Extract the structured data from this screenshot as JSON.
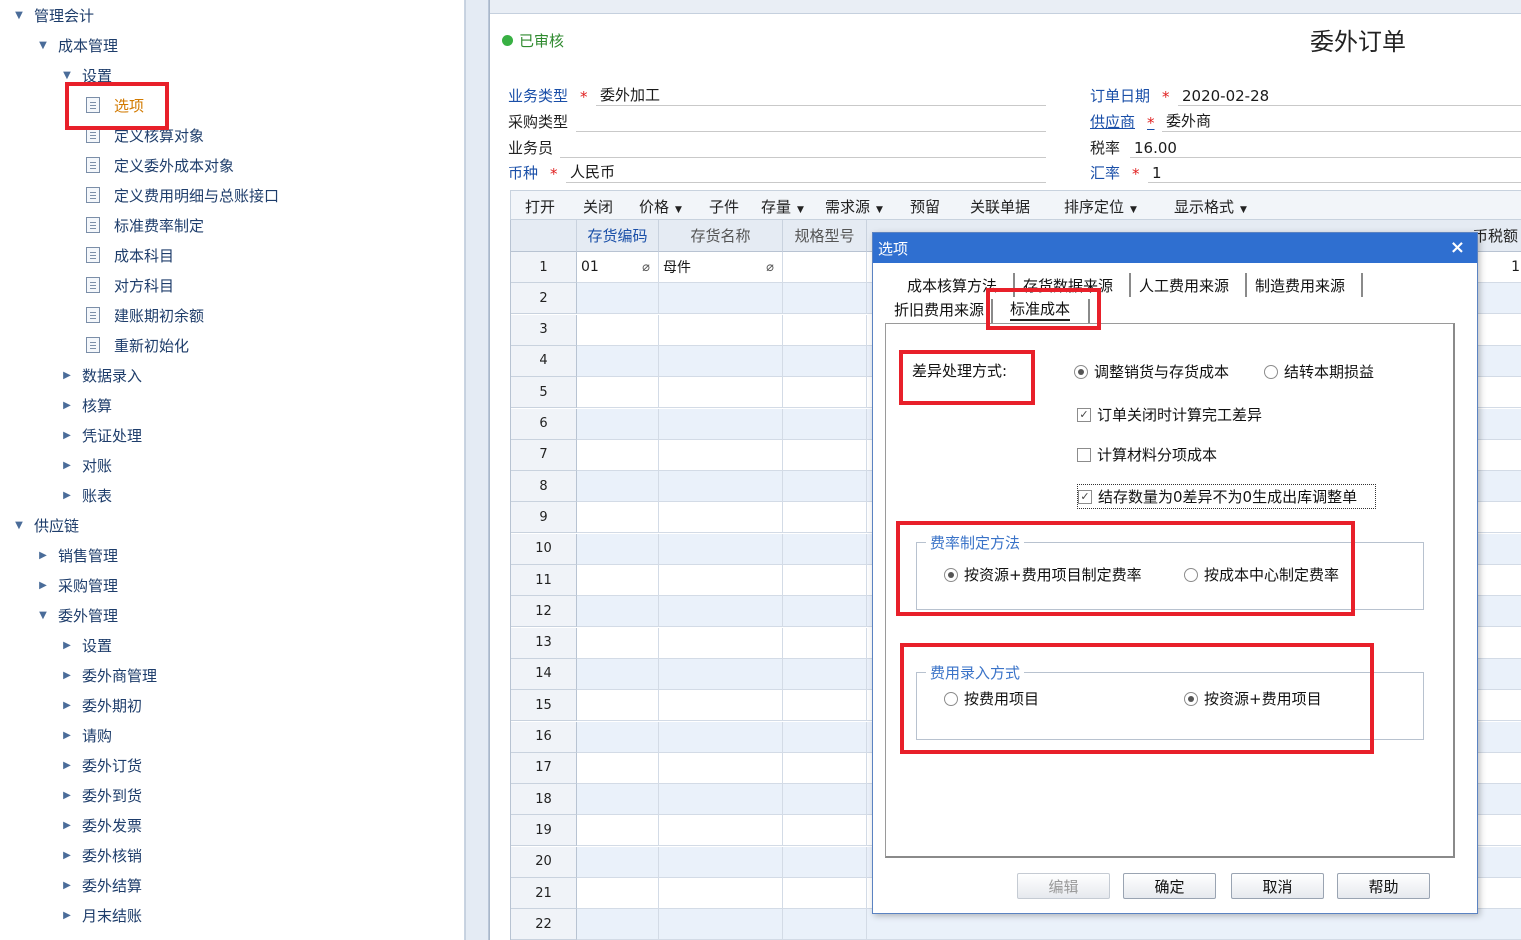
{
  "tree": {
    "items": [
      {
        "label": "管理会计",
        "kind": "expanded"
      },
      {
        "label": "成本管理",
        "kind": "expanded"
      },
      {
        "label": "设置",
        "kind": "expanded"
      },
      {
        "label": "选项",
        "kind": "doc"
      },
      {
        "label": "定义核算对象",
        "kind": "doc"
      },
      {
        "label": "定义委外成本对象",
        "kind": "doc"
      },
      {
        "label": "定义费用明细与总账接口",
        "kind": "doc"
      },
      {
        "label": "标准费率制定",
        "kind": "doc"
      },
      {
        "label": "成本科目",
        "kind": "doc"
      },
      {
        "label": "对方科目",
        "kind": "doc"
      },
      {
        "label": "建账期初余额",
        "kind": "doc"
      },
      {
        "label": "重新初始化",
        "kind": "doc"
      },
      {
        "label": "数据录入",
        "kind": "collapsed"
      },
      {
        "label": "核算",
        "kind": "collapsed"
      },
      {
        "label": "凭证处理",
        "kind": "collapsed"
      },
      {
        "label": "对账",
        "kind": "collapsed"
      },
      {
        "label": "账表",
        "kind": "collapsed"
      },
      {
        "label": "供应链",
        "kind": "expanded"
      },
      {
        "label": "销售管理",
        "kind": "collapsed"
      },
      {
        "label": "采购管理",
        "kind": "collapsed"
      },
      {
        "label": "委外管理",
        "kind": "expanded"
      },
      {
        "label": "设置",
        "kind": "collapsed"
      },
      {
        "label": "委外商管理",
        "kind": "collapsed"
      },
      {
        "label": "委外期初",
        "kind": "collapsed"
      },
      {
        "label": "请购",
        "kind": "collapsed"
      },
      {
        "label": "委外订货",
        "kind": "collapsed"
      },
      {
        "label": "委外到货",
        "kind": "collapsed"
      },
      {
        "label": "委外发票",
        "kind": "collapsed"
      },
      {
        "label": "委外核销",
        "kind": "collapsed"
      },
      {
        "label": "委外结算",
        "kind": "collapsed"
      },
      {
        "label": "月末结账",
        "kind": "collapsed"
      }
    ]
  },
  "doc": {
    "status": "已审核",
    "title": "委外订单",
    "fields": {
      "biz_type_label": "业务类型",
      "biz_type_value": "委外加工",
      "purchase_type_label": "采购类型",
      "purchase_type_value": "",
      "staff_label": "业务员",
      "staff_value": "",
      "currency_label": "币种",
      "currency_value": "人民币",
      "order_date_label": "订单日期",
      "order_date_value": "2020-02-28",
      "supplier_label": "供应商",
      "supplier_value": "委外商",
      "tax_label": "税率",
      "tax_value": "16.00",
      "rate_label": "汇率",
      "rate_value": "1",
      "required_mark": "*"
    }
  },
  "grid_toolbar": {
    "open": "打开",
    "close": "关闭",
    "price": "价格",
    "child": "子件",
    "stock": "存量",
    "demand": "需求源",
    "reserve": "预留",
    "related": "关联单据",
    "sort": "排序定位",
    "display": "显示格式"
  },
  "grid": {
    "headers": {
      "code": "存货编码",
      "name": "存货名称",
      "spec": "规格型号",
      "tax_col": "币税额"
    },
    "rows": [
      {
        "n": "1",
        "code": "01",
        "name": "母件",
        "right": "1"
      },
      {
        "n": "2"
      },
      {
        "n": "3"
      },
      {
        "n": "4"
      },
      {
        "n": "5"
      },
      {
        "n": "6"
      },
      {
        "n": "7"
      },
      {
        "n": "8"
      },
      {
        "n": "9"
      },
      {
        "n": "10"
      },
      {
        "n": "11"
      },
      {
        "n": "12"
      },
      {
        "n": "13"
      },
      {
        "n": "14"
      },
      {
        "n": "15"
      },
      {
        "n": "16"
      },
      {
        "n": "17"
      },
      {
        "n": "18"
      },
      {
        "n": "19"
      },
      {
        "n": "20"
      },
      {
        "n": "21"
      },
      {
        "n": "22"
      }
    ]
  },
  "dialog": {
    "title": "选项",
    "close": "×",
    "tabs": {
      "t1": "成本核算方法",
      "t2": "存货数据来源",
      "t3": "人工费用来源",
      "t4": "制造费用来源",
      "t5": "折旧费用来源",
      "t6": "标准成本"
    },
    "diff_label": "差异处理方式:",
    "diff_opt1": "调整销货与存货成本",
    "diff_opt2": "结转本期损益",
    "chk1": "订单关闭时计算完工差异",
    "chk2": "计算材料分项成本",
    "chk3": "结存数量为0差异不为0生成出库调整单",
    "group1_title": "费率制定方法",
    "group1_opt1": "按资源+费用项目制定费率",
    "group1_opt2": "按成本中心制定费率",
    "group2_title": "费用录入方式",
    "group2_opt1": "按费用项目",
    "group2_opt2": "按资源+费用项目",
    "buttons": {
      "edit": "编辑",
      "ok": "确定",
      "cancel": "取消",
      "help": "帮助"
    },
    "state": {
      "diff": 1,
      "chk1": true,
      "chk2": false,
      "chk3": true,
      "group1": 1,
      "group2": 2
    }
  }
}
